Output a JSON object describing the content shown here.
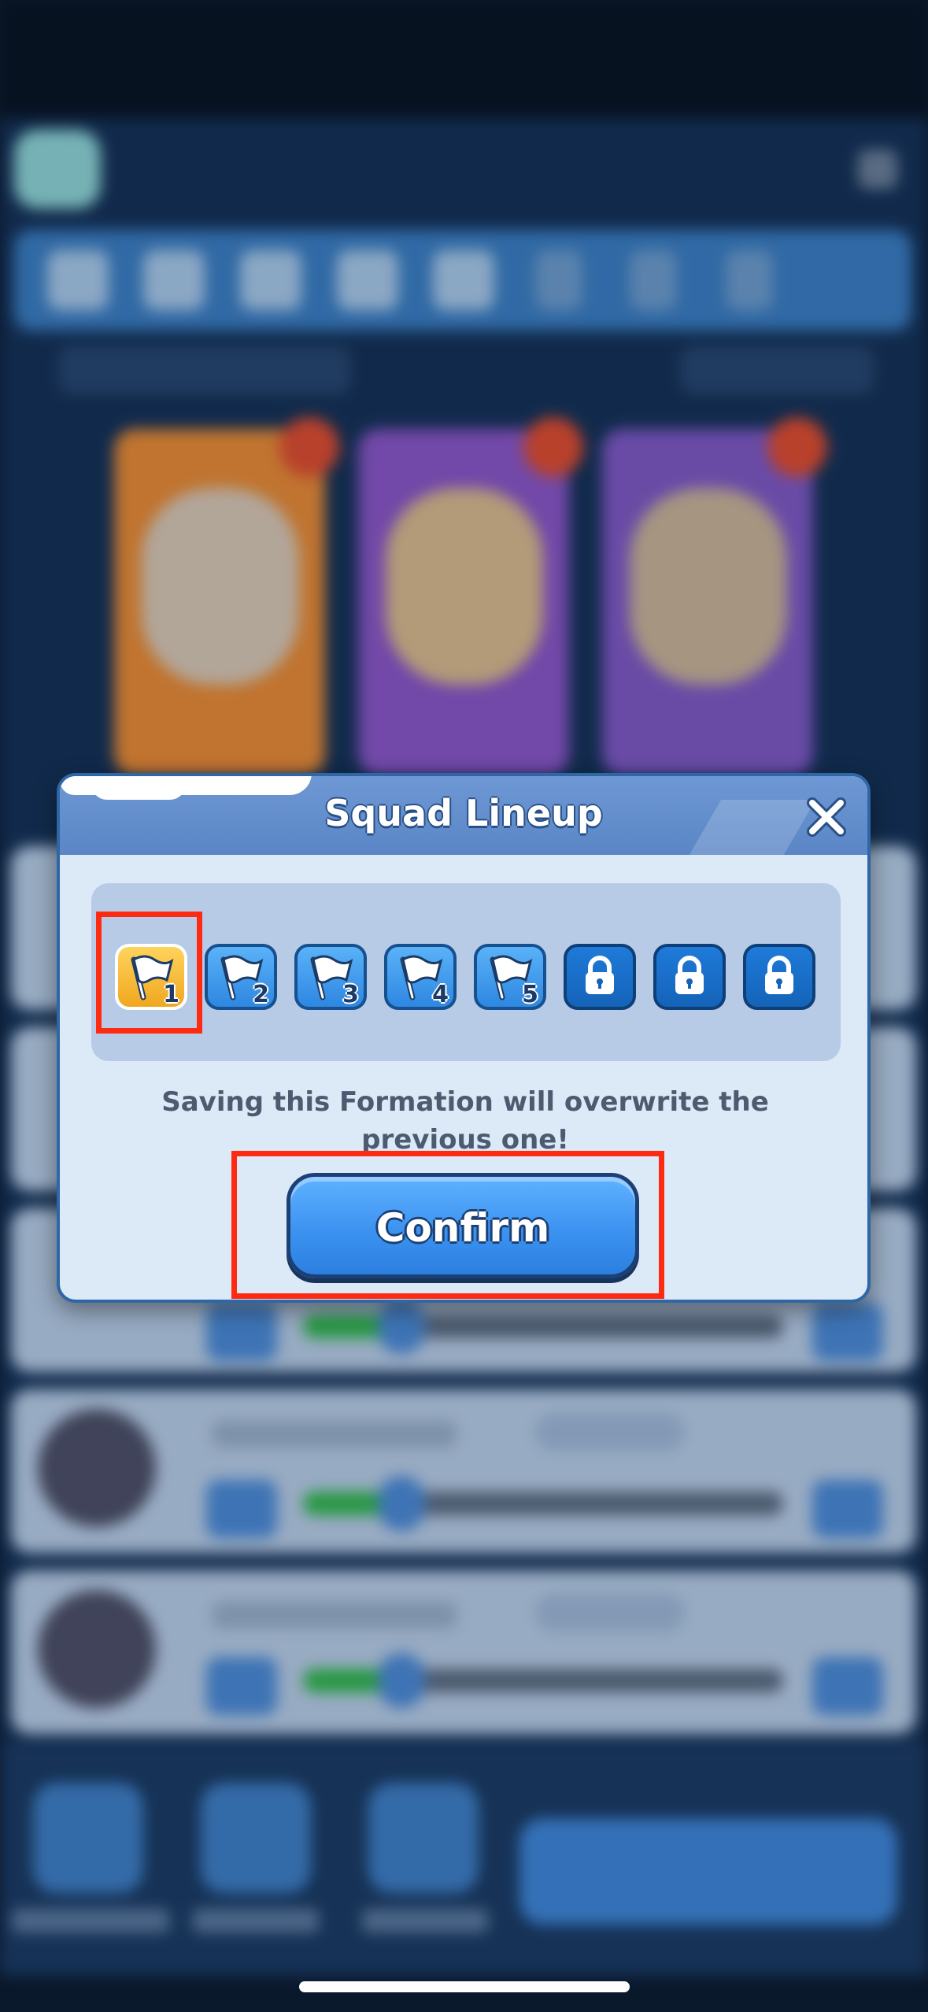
{
  "dialog": {
    "title": "Squad Lineup",
    "message": "Saving this Formation will overwrite the previous one!",
    "confirm_label": "Confirm",
    "slots": [
      {
        "num": "1",
        "state": "selected"
      },
      {
        "num": "2",
        "state": "available"
      },
      {
        "num": "3",
        "state": "available"
      },
      {
        "num": "4",
        "state": "available"
      },
      {
        "num": "5",
        "state": "available"
      },
      {
        "num": "",
        "state": "locked"
      },
      {
        "num": "",
        "state": "locked"
      },
      {
        "num": "",
        "state": "locked"
      }
    ]
  },
  "colors": {
    "highlight": "#ff2a12",
    "selected_slot": "#f0a71f",
    "slot_blue": "#2e87e1",
    "confirm_blue": "#3c93f0"
  }
}
